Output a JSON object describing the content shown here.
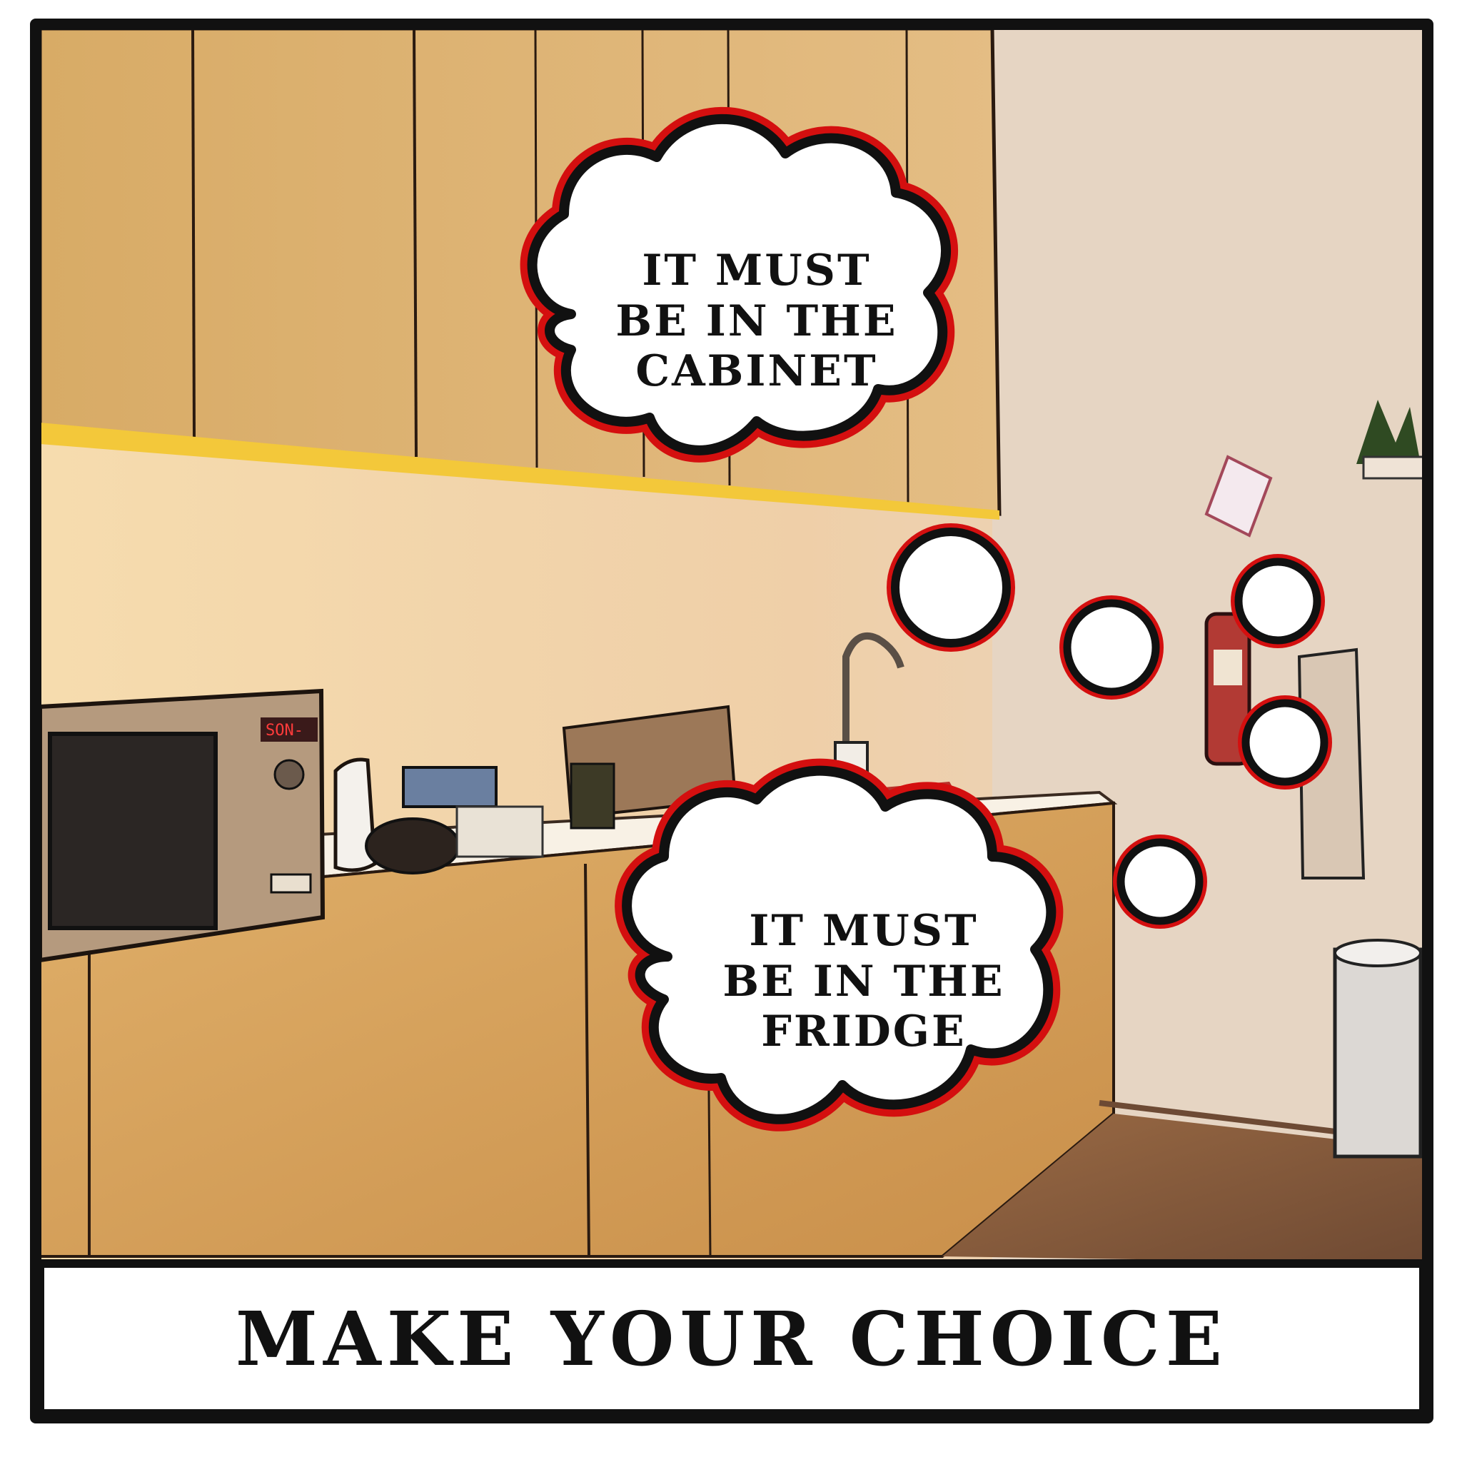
{
  "thoughts": {
    "cabinet": "IT MUST\nBE IN THE\nCABINET",
    "fridge": "IT MUST\nBE IN THE\nFRIDGE"
  },
  "caption": "MAKE YOUR CHOICE",
  "appliances": {
    "microwave_display": "SON-"
  },
  "colors": {
    "frame": "#111111",
    "bubble_outline": "#d40f0f",
    "bubble_fill": "#ffffff",
    "cabinet_wood": "#d6a860",
    "wall": "#f2d7b4",
    "counter": "#f7f0e4",
    "floor": "#8a5c3c",
    "under_cabinet_light": "#f3c83a"
  }
}
